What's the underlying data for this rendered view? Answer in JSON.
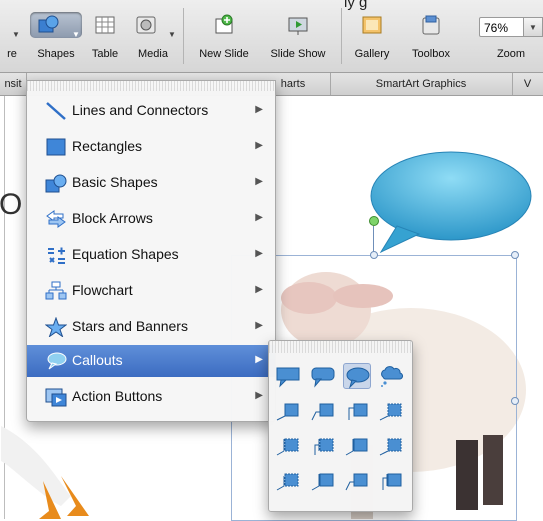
{
  "window": {
    "title_partial": "ly g"
  },
  "toolbar": {
    "buttons": [
      {
        "label": "re"
      },
      {
        "label": "Shapes"
      },
      {
        "label": "Table"
      },
      {
        "label": "Media"
      },
      {
        "label": "New Slide"
      },
      {
        "label": "Slide Show"
      },
      {
        "label": "Gallery"
      },
      {
        "label": "Toolbox"
      },
      {
        "label": "Zoom"
      }
    ],
    "zoom_value": "76%"
  },
  "ribbon_tabs": [
    "nsit",
    "harts",
    "SmartArt Graphics",
    "V"
  ],
  "canvas": {
    "partial_text": "O"
  },
  "shapes_menu": {
    "items": [
      {
        "label": "Lines and Connectors",
        "icon": "line-icon"
      },
      {
        "label": "Rectangles",
        "icon": "rectangle-icon"
      },
      {
        "label": "Basic Shapes",
        "icon": "basic-shapes-icon"
      },
      {
        "label": "Block Arrows",
        "icon": "block-arrows-icon"
      },
      {
        "label": "Equation Shapes",
        "icon": "equation-icon"
      },
      {
        "label": "Flowchart",
        "icon": "flowchart-icon"
      },
      {
        "label": "Stars and Banners",
        "icon": "star-icon"
      },
      {
        "label": "Callouts",
        "icon": "callout-icon",
        "selected": true
      },
      {
        "label": "Action Buttons",
        "icon": "action-button-icon"
      }
    ]
  },
  "callouts_submenu": {
    "rows": 4,
    "cols": 4,
    "highlighted_index": 2,
    "accent_color": "#4a8fd2"
  },
  "colors": {
    "menu_selected": "#3c6cc1",
    "callout_fill": "#4eb4dc",
    "rotation_handle": "#7ed36a"
  }
}
